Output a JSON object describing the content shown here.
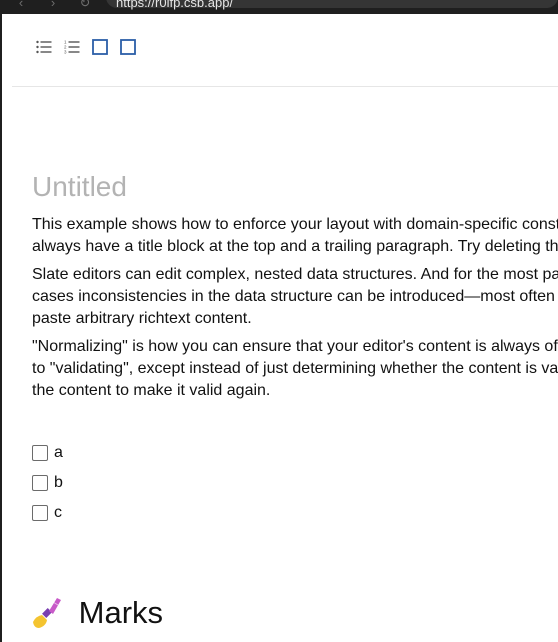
{
  "browser": {
    "url": "https://r0ifp.csb.app/"
  },
  "toolbar": {
    "buttons": [
      {
        "name": "bulleted-list",
        "active": false
      },
      {
        "name": "numbered-list",
        "active": false
      },
      {
        "name": "block-1",
        "active": true
      },
      {
        "name": "block-2",
        "active": true
      }
    ],
    "accent_color": "#2b5ea8"
  },
  "editor": {
    "title": "Untitled",
    "paragraphs": [
      [
        "This example shows how to enforce your layout with domain-specific const",
        "always have a title block at the top and a trailing paragraph. Try deleting th"
      ],
      [
        "Slate editors can edit complex, nested data structures. And for the most pa",
        "cases inconsistencies in the data structure can be introduced—most often",
        "paste arbitrary richtext content."
      ],
      [
        "\"Normalizing\" is how you can ensure that your editor's content is always of",
        "to \"validating\", except instead of just determining whether the content is va",
        "the content to make it valid again."
      ]
    ],
    "checklist": [
      {
        "label": "a",
        "checked": false
      },
      {
        "label": "b",
        "checked": false
      },
      {
        "label": "c",
        "checked": false
      }
    ],
    "section_heading": "Marks",
    "section_icon": "nail-polish-icon"
  }
}
